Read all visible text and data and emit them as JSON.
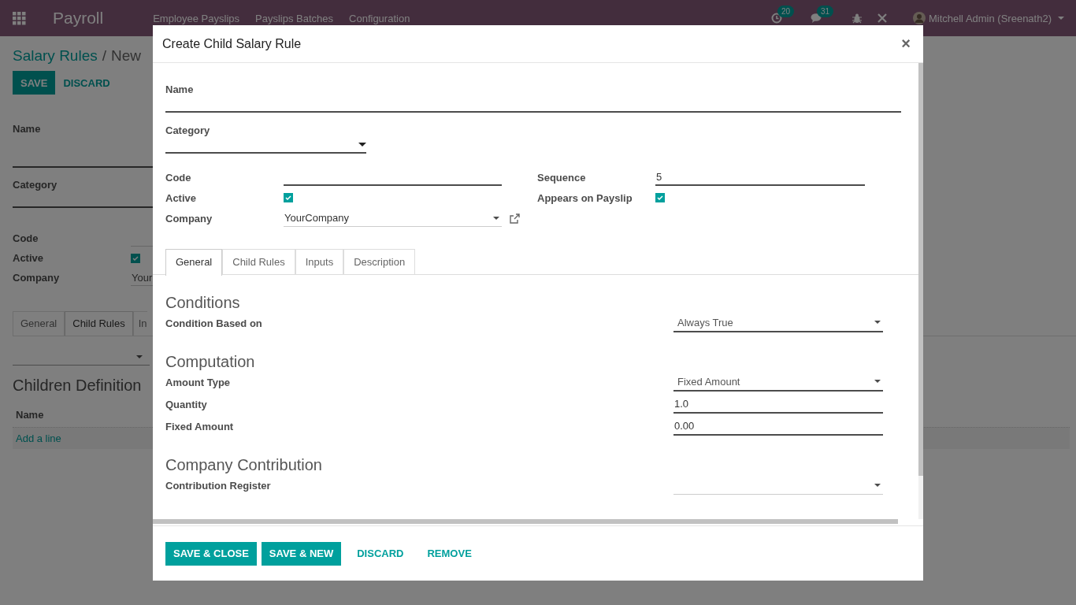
{
  "app": {
    "title": "Payroll",
    "menu": [
      "Employee Payslips",
      "Payslips Batches",
      "Configuration"
    ],
    "activity_count": "20",
    "message_count": "31",
    "user": "Mitchell Admin (Sreenath2)"
  },
  "background": {
    "breadcrumb": [
      "Salary Rules",
      "New"
    ],
    "breadcrumb_separator": "/",
    "buttons": [
      {
        "label": "SAVE",
        "kind": "primary"
      },
      {
        "label": "DISCARD",
        "kind": "link"
      }
    ],
    "fields": [
      {
        "label": "Name",
        "kind": "title"
      },
      {
        "label": "Category",
        "kind": "wide"
      },
      {
        "label": "Code",
        "kind": "text"
      },
      {
        "label": "Active",
        "kind": "checkbox",
        "checked": true
      },
      {
        "label": "Company",
        "kind": "text",
        "value": "Your"
      }
    ],
    "tabs": [
      {
        "label": "General",
        "selected": false
      },
      {
        "label": "Child Rules",
        "selected": true
      },
      {
        "label": "In",
        "selected": false
      }
    ],
    "section_title": "Children Definition",
    "list_columns": [
      "Name"
    ],
    "add_line": "Add a line"
  },
  "dialog": {
    "title": "Create Child Salary Rule",
    "close": "×",
    "name_label": "Name",
    "category_label": "Category",
    "left_fields": [
      {
        "label": "Code",
        "kind": "text",
        "required": true
      },
      {
        "label": "Active",
        "kind": "checkbox",
        "checked": true
      },
      {
        "label": "Company",
        "kind": "many2one",
        "value": "YourCompany",
        "required": false
      }
    ],
    "right_fields": [
      {
        "label": "Sequence",
        "kind": "text",
        "value": "5",
        "required": true
      },
      {
        "label": "Appears on Payslip",
        "kind": "checkbox",
        "checked": true
      }
    ],
    "tabs": [
      {
        "label": "General",
        "selected": true
      },
      {
        "label": "Child Rules",
        "selected": false
      },
      {
        "label": "Inputs",
        "selected": false
      },
      {
        "label": "Description",
        "selected": false
      }
    ],
    "sections": [
      {
        "title": "Conditions",
        "fields": [
          {
            "label": "Condition Based on",
            "kind": "select",
            "value": "Always True",
            "required": true
          }
        ]
      },
      {
        "title": "Computation",
        "fields": [
          {
            "label": "Amount Type",
            "kind": "select",
            "value": "Fixed Amount",
            "required": true
          },
          {
            "label": "Quantity",
            "kind": "text",
            "value": "1.0",
            "required": true
          },
          {
            "label": "Fixed Amount",
            "kind": "text",
            "value": "0.00",
            "required": true
          }
        ]
      },
      {
        "title": "Company Contribution",
        "fields": [
          {
            "label": "Contribution Register",
            "kind": "select",
            "required": false
          }
        ]
      }
    ],
    "buttons": [
      {
        "label": "SAVE & CLOSE",
        "kind": "primary"
      },
      {
        "label": "SAVE & NEW",
        "kind": "primary"
      },
      {
        "label": "DISCARD",
        "kind": "link"
      },
      {
        "label": "REMOVE",
        "kind": "link"
      }
    ]
  }
}
